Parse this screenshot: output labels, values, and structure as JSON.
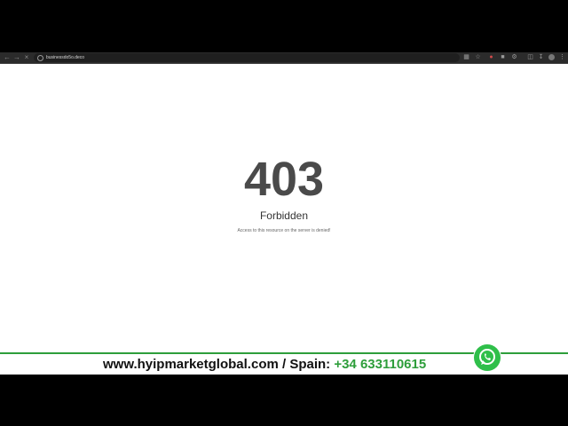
{
  "browser": {
    "back_icon": "back-arrow-icon",
    "forward_icon": "forward-arrow-icon",
    "reload_icon": "close-icon",
    "url": "businessdo5o.deco",
    "toolbar_icons": [
      "translate-icon",
      "star-icon",
      "extension-icon",
      "extension-icon",
      "puzzle-icon",
      "sidebar-icon",
      "download-icon",
      "avatar",
      "menu-icon"
    ]
  },
  "page": {
    "status_code": "403",
    "status_text": "Forbidden",
    "message": "Access to this resource on the server is denied!"
  },
  "banner": {
    "site": "www.hyipmarketglobal.com / Spain: ",
    "phone": "+34 633110615",
    "accent_color": "#2e9e3b",
    "whatsapp_icon": "whatsapp-icon"
  }
}
